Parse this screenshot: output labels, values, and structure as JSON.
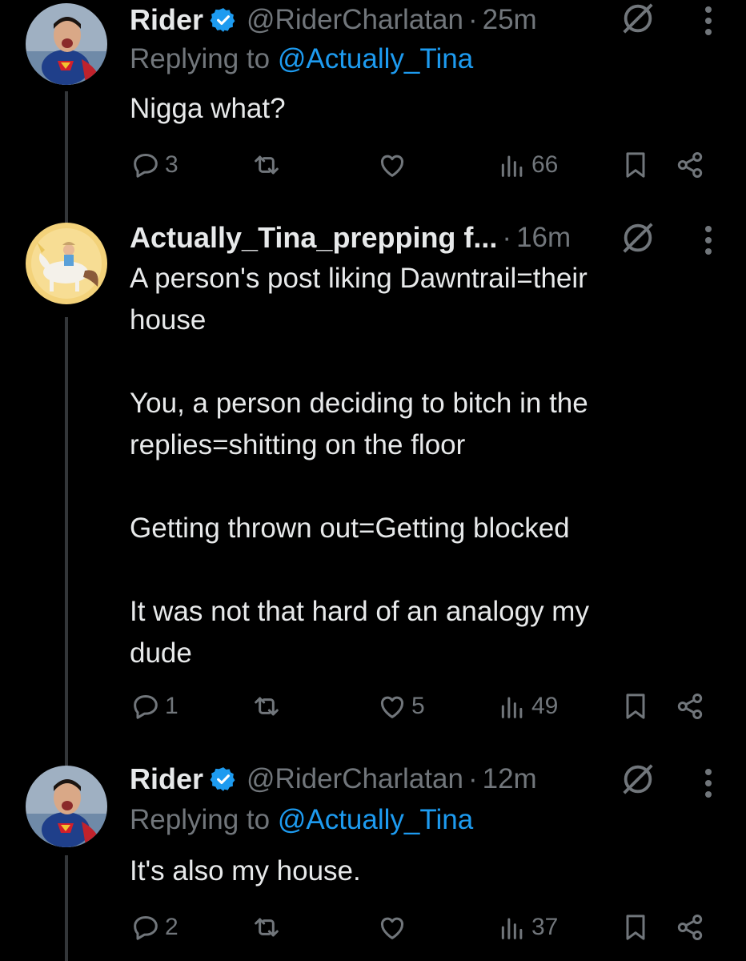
{
  "tweets": [
    {
      "name": "Rider",
      "handle": "@RiderCharlatan",
      "dot": "·",
      "time": "25m",
      "replying_prefix": "Replying to ",
      "replying_to": "@Actually_Tina",
      "text": "Nigga what?",
      "replies": "3",
      "retweets": "",
      "likes": "",
      "views": "66",
      "avatar_icon": "superman-avatar",
      "verified": true
    },
    {
      "name": "Actually_Tina_prepping f...",
      "handle": "",
      "dot": "·",
      "time": "16m",
      "text": "A person's post liking Dawntrail=their\nhouse\n\nYou, a person deciding to bitch in the\nreplies=shitting on the floor\n\nGetting thrown out=Getting blocked\n\nIt was not that hard of an analogy my\ndude",
      "replies": "1",
      "retweets": "",
      "likes": "5",
      "views": "49",
      "avatar_icon": "unicorn-rider-avatar",
      "verified": false
    },
    {
      "name": "Rider",
      "handle": "@RiderCharlatan",
      "dot": "·",
      "time": "12m",
      "replying_prefix": "Replying to ",
      "replying_to": "@Actually_Tina",
      "text": "It's also my house.",
      "replies": "2",
      "retweets": "",
      "likes": "",
      "views": "37",
      "avatar_icon": "superman-avatar",
      "verified": true
    }
  ],
  "colors": {
    "background": "#000000",
    "text": "#e7e9ea",
    "muted": "#71767b",
    "link": "#1d9bf0",
    "verified": "#1d9bf0",
    "thread_line": "#333639"
  }
}
